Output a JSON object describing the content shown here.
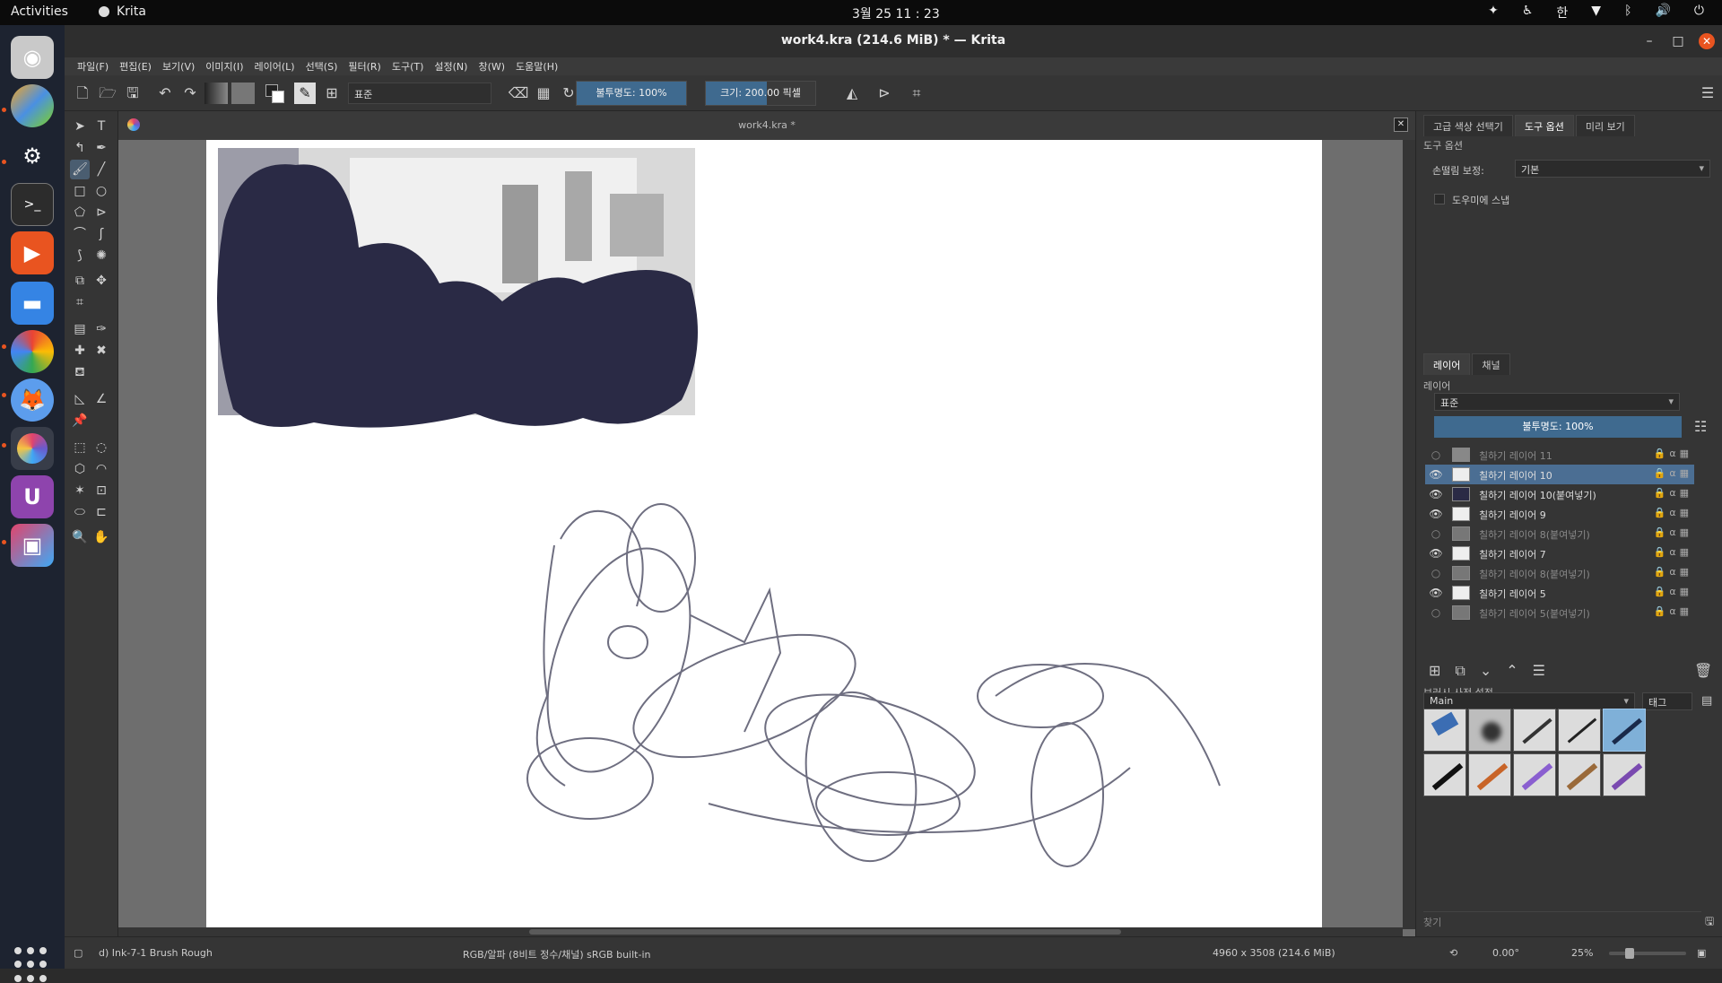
{
  "system": {
    "activities": "Activities",
    "app_name": "Krita",
    "clock": "3월 25  11 : 23",
    "ime": "한"
  },
  "window": {
    "title": "work4.kra (214.6 MiB)  * — Krita"
  },
  "menu": [
    "파일(F)",
    "편집(E)",
    "보기(V)",
    "이미지(I)",
    "레이어(L)",
    "선택(S)",
    "필터(R)",
    "도구(T)",
    "설정(N)",
    "창(W)",
    "도움말(H)"
  ],
  "toolbar": {
    "blend_mode": "표준",
    "opacity_label": "불투명도: 100%",
    "opacity_value": 1.0,
    "size_label": "크기: 200.00 픽셀"
  },
  "document": {
    "tab_label": "work4.kra *"
  },
  "right_dock": {
    "top_tabs": [
      "고급 색상 선택기",
      "도구 옵션",
      "미리 보기"
    ],
    "tool_options_title": "도구 옵션",
    "stabilizer_label": "손떨림 보정:",
    "stabilizer_value": "기본",
    "snap_label": "도우미에 스냅",
    "layer_tabs": [
      "레이어",
      "채널"
    ],
    "layers_title": "레이어",
    "layer_blend": "표준",
    "layer_opacity": "불투명도:  100%",
    "layers": [
      {
        "name": "칠하기 레이어 11",
        "visible": false,
        "selected": false
      },
      {
        "name": "칠하기 레이어 10",
        "visible": true,
        "selected": true
      },
      {
        "name": "칠하기 레이어 10(붙여넣기)",
        "visible": true,
        "selected": false
      },
      {
        "name": "칠하기 레이어 9",
        "visible": true,
        "selected": false
      },
      {
        "name": "칠하기 레이어 8(붙여넣기)",
        "visible": false,
        "selected": false
      },
      {
        "name": "칠하기 레이어 7",
        "visible": true,
        "selected": false
      },
      {
        "name": "칠하기 레이어 8(붙여넣기)",
        "visible": false,
        "selected": false
      },
      {
        "name": "칠하기 레이어 5",
        "visible": true,
        "selected": false
      },
      {
        "name": "칠하기 레이어 5(붙여넣기)",
        "visible": false,
        "selected": false
      }
    ],
    "brush_presets_title": "브러시 사전 설정",
    "brush_tag_value": "Main",
    "brush_tag_button": "태그",
    "search_placeholder": "찾기"
  },
  "status": {
    "brush_name": "d) Ink-7-1 Brush Rough",
    "color_space": "RGB/알파 (8비트 정수/채널)  sRGB built-in",
    "dimensions": "4960 x 3508 (214.6 MiB)",
    "rotation": "0.00°",
    "zoom": "25%"
  },
  "colors": {
    "accent": "#3f6a8f",
    "selected_layer": "#4b6e93",
    "paint_blob": "#2a2a45",
    "ubuntu_orange": "#e95420"
  }
}
